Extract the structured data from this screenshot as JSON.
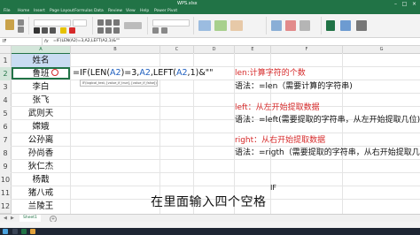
{
  "window": {
    "title": "WPS.xlsx"
  },
  "ribbon_tabs": [
    "File",
    "Home",
    "Insert",
    "Page Layout",
    "Formulas",
    "Data",
    "Review",
    "View",
    "Help",
    "Power Pivot"
  ],
  "formula_bar": {
    "name_box": "IF",
    "fx": "fx",
    "content": "=IF(LEN(A2)=3,A2,LEFT(A2,1)&\"\""
  },
  "columns": [
    "A",
    "B",
    "C",
    "D",
    "E",
    "F",
    "G"
  ],
  "rows": [
    "1",
    "2",
    "3",
    "4",
    "5",
    "6",
    "7",
    "8",
    "9",
    "10",
    "11",
    "12"
  ],
  "column_a": {
    "header": "姓名",
    "names": [
      "鲁班",
      "李白",
      "张飞",
      "武则天",
      "嫦娥",
      "公孙离",
      "孙尚香",
      "狄仁杰",
      "杨戬",
      "猪八戒",
      "兰陵王"
    ]
  },
  "editing_formula": {
    "prefix": "=IF(LEN(",
    "ref1": "A2",
    "mid1": ")=3,",
    "ref2": "A2",
    "mid2": ",LEFT(",
    "ref3": "A2",
    "tail": ",1)&\"\""
  },
  "function_tooltip": "IF(logical_test, [value_if_true], [value_if_false])",
  "notes": [
    {
      "text": "len:计算字符的个数",
      "color": "red"
    },
    {
      "text": "语法：=len（需要计算的字符串)",
      "color": "black"
    },
    {
      "text": "left：从左开始提取数据",
      "color": "red"
    },
    {
      "text": "语法：=left(需要提取的字符串，从左开始提取几位)",
      "color": "black"
    },
    {
      "text": "right：从右开始提取数据",
      "color": "red"
    },
    {
      "text": "语法：=rigth（需要提取的字符串，从右开始提取几位)",
      "color": "black"
    }
  ],
  "if_hint": "IF",
  "subtitle": "在里面输入四个空格",
  "sheet_tab": "Sheet1",
  "colors": {
    "excel_green": "#217346",
    "note_red": "#d62a2a",
    "header_fill": "#c9dcf2",
    "ref_blue": "#1f5fbf"
  }
}
